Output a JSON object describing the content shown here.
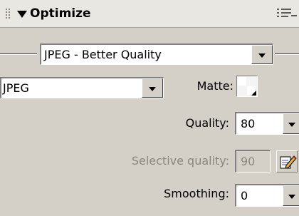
{
  "panel": {
    "title": "Optimize",
    "preset": "JPEG - Better Quality",
    "format": "JPEG",
    "matte_label": "Matte:",
    "quality_label": "Quality:",
    "quality_value": "80",
    "selective_quality_label": "Selective quality:",
    "selective_quality_value": "90",
    "smoothing_label": "Smoothing:",
    "smoothing_value": "0"
  },
  "icons": {
    "gripper": "gripper-icon",
    "collapse": "collapse-arrow-icon",
    "options_menu": "options-menu-icon",
    "edit": "pencil-edit-icon"
  },
  "colors": {
    "panel_bg": "#d4d0c8",
    "titlebar_bg": "#e9e7e1",
    "disabled_text": "#8a877f"
  }
}
